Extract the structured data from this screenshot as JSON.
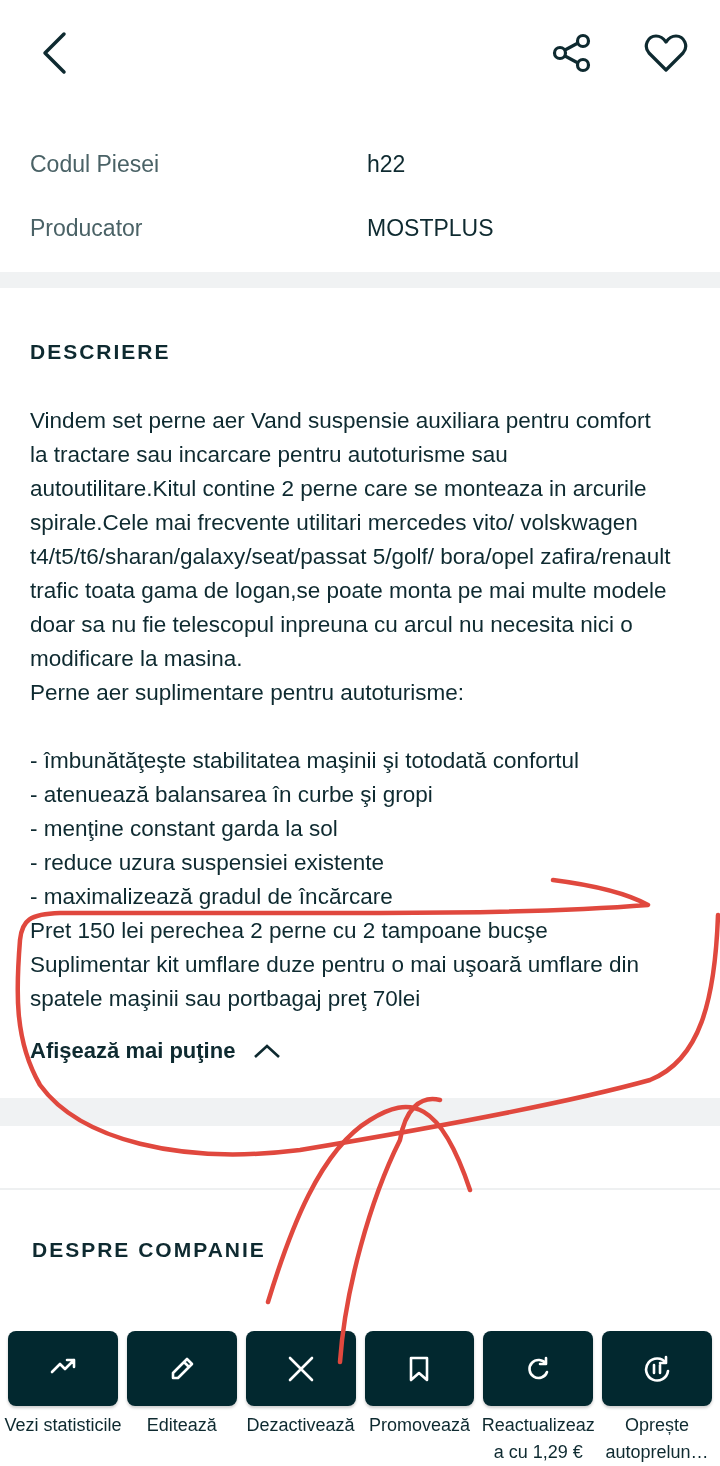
{
  "specs": [
    {
      "label": "Codul Piesei",
      "value": "h22"
    },
    {
      "label": "Producator",
      "value": "MOSTPLUS"
    }
  ],
  "description": {
    "title": "DESCRIERE",
    "paragraphs": [
      "Vindem set perne aer Vand suspensie auxiliara pentru comfort la tractare sau incarcare pentru autoturisme sau autoutilitare.Kitul contine 2 perne care se monteaza in arcurile spirale.Cele mai frecvente utilitari mercedes vito/ volskwagen t4/t5/t6/sharan/galaxy/seat/passat 5/golf/ bora/opel zafira/renault trafic toata gama de logan,se poate monta pe mai multe modele doar sa nu fie telescopul inpreuna cu arcul nu necesita nici o modificare la masina.",
      "Perne aer suplimentare pentru autoturisme:",
      "- îmbunătăţeşte stabilitatea maşinii şi totodată confortul",
      "- atenuează balansarea în curbe şi gropi",
      "- menţine constant garda la sol",
      "- reduce uzura suspensiei existente",
      "- maximalizează gradul de încărcare",
      "Pret 150 lei perechea 2 perne cu 2 tampoane bucşe",
      "Suplimentar kit umflare duze pentru o mai uşoară umflare din spatele maşinii sau portbagaj preţ 70lei"
    ],
    "spaced_after": [
      false,
      true,
      false,
      false,
      false,
      false,
      false,
      false,
      false
    ],
    "toggle": {
      "label": "Afişează mai puţine",
      "expanded": true
    }
  },
  "company": {
    "title": "DESPRE COMPANIE"
  },
  "actions": [
    {
      "kind": "stats",
      "label": "Vezi statisticile"
    },
    {
      "kind": "edit",
      "label": "Editează"
    },
    {
      "kind": "deactivate",
      "label": "Dezactivează"
    },
    {
      "kind": "promote",
      "label": "Promovează"
    },
    {
      "kind": "refresh",
      "label": "Reactualizeaza cu 1,29 €"
    },
    {
      "kind": "pause",
      "label": "Oprește autoprelun…"
    }
  ],
  "annotation": {
    "kind": "scribble"
  }
}
